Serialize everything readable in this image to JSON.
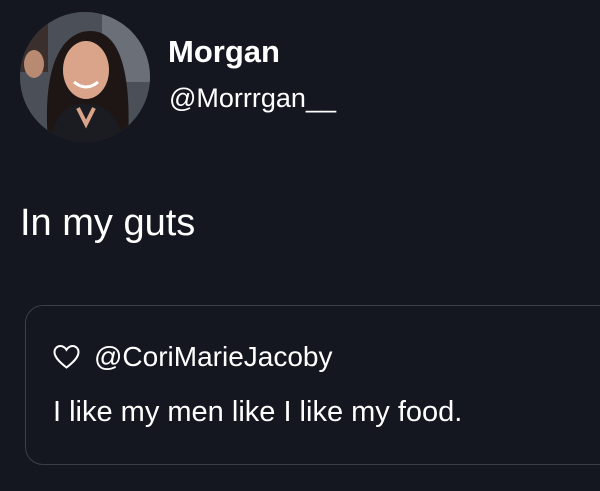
{
  "tweet": {
    "author": {
      "display_name": "Morgan",
      "handle": "@Morrrgan__"
    },
    "text": "In my guts",
    "quoted": {
      "icon": "heart-outline-icon",
      "handle": "@CoriMarieJacoby",
      "text": "I like my men like I like my food."
    }
  },
  "theme": {
    "background": "#141720",
    "text": "#ffffff",
    "border": "#3b3f4b"
  }
}
